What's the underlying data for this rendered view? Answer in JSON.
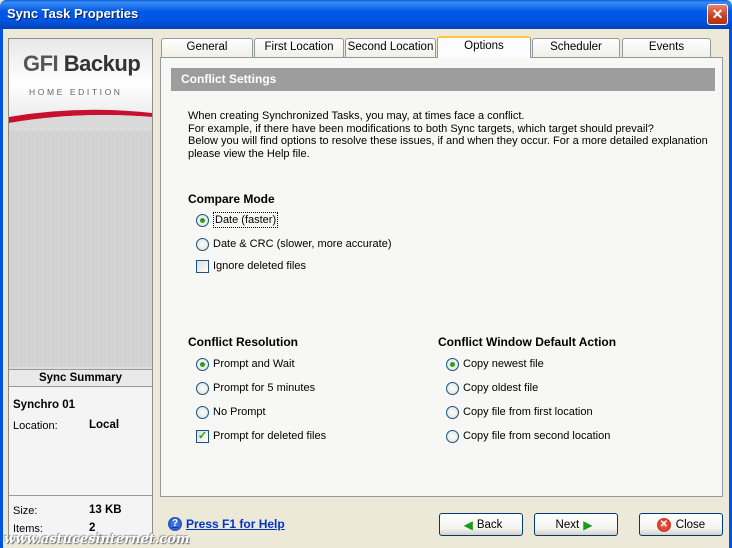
{
  "window": {
    "title": "Sync Task Properties",
    "close_glyph": "✕"
  },
  "logo": {
    "brand": "GFI Backup",
    "brand_prefix": "GFI",
    "brand_name": "Backup",
    "edition": "HOME EDITION"
  },
  "summary": {
    "header": "Sync Summary",
    "task_name": "Synchro 01",
    "location_label": "Location:",
    "location_value": "Local",
    "size_label": "Size:",
    "size_value": "13 KB",
    "items_label": "Items:",
    "items_value": "2"
  },
  "tabs": [
    {
      "label": "General",
      "active": false
    },
    {
      "label": "First Location",
      "active": false
    },
    {
      "label": "Second Location",
      "active": false
    },
    {
      "label": "Options",
      "active": true
    },
    {
      "label": "Scheduler",
      "active": false
    },
    {
      "label": "Events",
      "active": false
    }
  ],
  "section": {
    "title": "Conflict Settings",
    "description": [
      "When creating Synchronized Tasks, you may, at times face a conflict.",
      "For example, if there have been modifications to both Sync targets, which target should prevail?",
      "Below you will find options to resolve these issues, if and when they occur. For a more detailed explanation",
      "please view the Help file."
    ]
  },
  "compare_mode": {
    "title": "Compare Mode",
    "options": [
      {
        "label": "Date (faster)",
        "selected": true
      },
      {
        "label": "Date & CRC (slower, more accurate)",
        "selected": false
      }
    ],
    "ignore_deleted": {
      "label": "Ignore deleted files",
      "checked": false
    }
  },
  "conflict_resolution": {
    "title": "Conflict Resolution",
    "options": [
      {
        "label": "Prompt and Wait",
        "selected": true
      },
      {
        "label": "Prompt for 5 minutes",
        "selected": false
      },
      {
        "label": "No Prompt",
        "selected": false
      }
    ],
    "prompt_deleted": {
      "label": "Prompt for deleted files",
      "checked": true
    }
  },
  "default_action": {
    "title": "Conflict Window Default Action",
    "options": [
      {
        "label": "Copy newest file",
        "selected": true
      },
      {
        "label": "Copy oldest file",
        "selected": false
      },
      {
        "label": "Copy file from first location",
        "selected": false
      },
      {
        "label": "Copy file from second location",
        "selected": false
      }
    ]
  },
  "footer": {
    "help_label": "Press F1 for Help",
    "back_label": "Back",
    "next_label": "Next",
    "close_label": "Close"
  },
  "watermark": "www.astucesinternet.com",
  "colors": {
    "titlebar": "#0054e3",
    "section_header": "#9d9d9d",
    "radio_dot": "#21a121",
    "tab_highlight": "#ffc83c"
  }
}
